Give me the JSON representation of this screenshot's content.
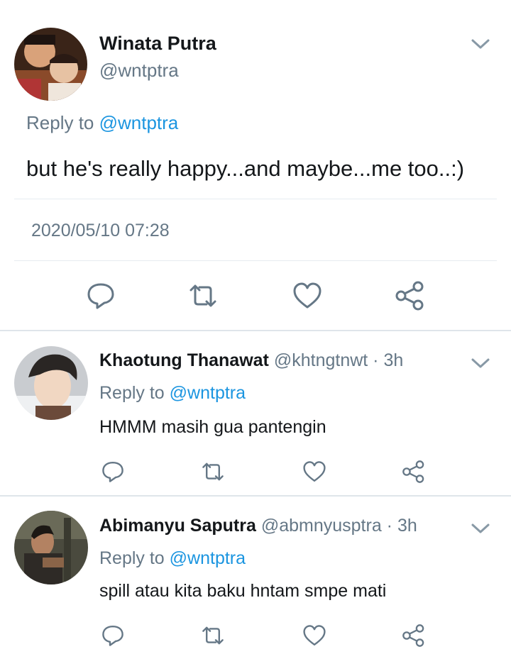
{
  "main_tweet": {
    "author_name": "Winata Putra",
    "author_handle": "@wntptra",
    "reply_prefix": "Reply to ",
    "reply_to": "@wntptra",
    "text": "but he's really happy...and maybe...me too..:)",
    "timestamp": "2020/05/10 07:28",
    "icons": [
      "reply-icon",
      "retweet-icon",
      "like-icon",
      "share-icon"
    ]
  },
  "replies": [
    {
      "author_name": "Khaotung Thanawat",
      "author_handle": "@khtngtnwt",
      "separator": " · ",
      "time": "3h",
      "reply_prefix": "Reply to ",
      "reply_to": "@wntptra",
      "text": "HMMM masih gua pantengin"
    },
    {
      "author_name": "Abimanyu Saputra",
      "author_handle": "@abmnyusptra",
      "separator": " · ",
      "time": "3h",
      "reply_prefix": "Reply to ",
      "reply_to": "@wntptra",
      "text": "spill atau kita baku hntam smpe mati"
    }
  ],
  "colors": {
    "text": "#14171a",
    "secondary": "#657786",
    "link": "#1b95e0",
    "divider": "#e6ecf0"
  }
}
